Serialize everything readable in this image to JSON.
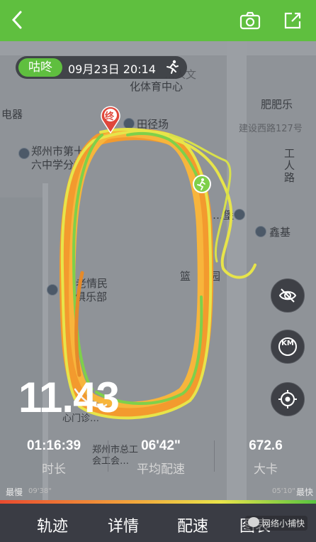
{
  "colors": {
    "brand_green": "#5fbf3f",
    "track_orange": "#f39a2e",
    "track_yellow": "#e5e84a",
    "start_green": "#7fd04a",
    "end_red": "#e0473b"
  },
  "top_bar": {
    "back_icon": "chevron-left-icon",
    "camera_icon": "camera-icon",
    "share_icon": "share-icon"
  },
  "header": {
    "brand": "咕咚",
    "datetime": "09月23日 20:14",
    "activity_icon": "running-icon"
  },
  "map": {
    "labels": [
      "化体育中心",
      "…人文",
      "电器",
      "田径场",
      "肥肥乐",
      "建设西路127号",
      "郑州市第十",
      "六中学分校",
      "工人路",
      "鑫基",
      "中老情民",
      "俱乐部",
      "篮",
      "园",
      "…堡",
      "郑州市总工",
      "会工会…",
      "心门诊…"
    ],
    "end_marker": "终",
    "start_marker_icon": "start-runner-icon"
  },
  "side_buttons": {
    "visibility_icon": "eye-off-icon",
    "km_label": "KM",
    "locate_icon": "locate-icon"
  },
  "summary": {
    "distance": "11.43"
  },
  "stats": [
    {
      "value": "01:16:39",
      "label": "时长"
    },
    {
      "value": "06'42\"",
      "label": "平均配速"
    },
    {
      "value": "672.6",
      "label": "大卡"
    }
  ],
  "pace_legend": {
    "slowest_label": "最慢",
    "slowest_value": "09'38\"",
    "fastest_value": "05'10\"",
    "fastest_label": "最快"
  },
  "tabs": [
    "轨迹",
    "详情",
    "配速",
    "图表"
  ],
  "watermark": "网络小捕快"
}
